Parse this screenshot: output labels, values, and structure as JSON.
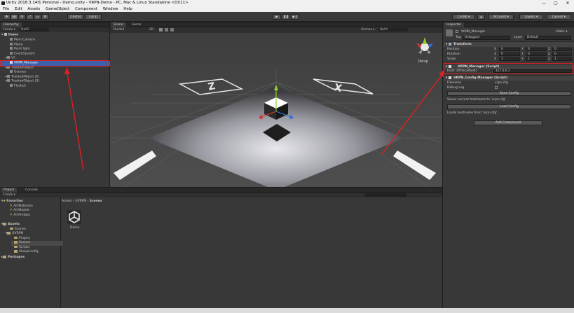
{
  "window": {
    "title": "Unity 2018.3.14f1 Personal - Demo.unity - VRPN-Demo - PC, Mac & Linux Standalone <DX11>",
    "controls": [
      "—",
      "▢",
      "✕"
    ]
  },
  "menu": [
    "File",
    "Edit",
    "Assets",
    "GameObject",
    "Component",
    "Window",
    "Help"
  ],
  "toolbar": {
    "tools": [
      "✥",
      "✛",
      "⟳",
      "⤢",
      "▭",
      "⚙"
    ],
    "center_label": "Center",
    "local_label": "Local",
    "play": "▶",
    "pause": "❚❚",
    "step": "▶❙",
    "collab_label": "Collab ▾",
    "cloud": "☁",
    "account_label": "Account ▾",
    "layers_label": "Layers ▾",
    "layout_label": "Layout ▾"
  },
  "hierarchy": {
    "tab": "Hierarchy",
    "create": "Create ▾",
    "search": "Q▾All",
    "scene_name": "Demo",
    "items": [
      "Main Camera",
      "Plane",
      "Point light",
      "EventSystem",
      "UI",
      "VRPN_Manager",
      "TrackedObject",
      "Glasses",
      "TrackedObject (2)",
      "TrackedObject (3)",
      "Flystick"
    ]
  },
  "scene_view": {
    "tabs": [
      "Scene",
      "Game"
    ],
    "shading": "Shaded",
    "mode_2d": "2D",
    "gizmos": "Gizmos ▾",
    "search": "Q▾All",
    "persp": "Persp",
    "axis_z": "Z",
    "axis_x": "X"
  },
  "inspector": {
    "tab": "Inspector",
    "object_name": "VRPN_Manager",
    "static_label": "Static ▾",
    "tag_label": "Tag",
    "tag_value": "Untagged",
    "layer_label": "Layer",
    "layer_value": "Default",
    "transform": {
      "title": "Transform",
      "position": {
        "label": "Position",
        "x": "0",
        "y": "0",
        "z": "0"
      },
      "rotation": {
        "label": "Rotation",
        "x": "0",
        "y": "0",
        "z": "0"
      },
      "scale": {
        "label": "Scale",
        "x": "1",
        "y": "1",
        "z": "1"
      }
    },
    "vrpn_manager": {
      "title": "VRPN_Manager (Script)",
      "host_label": "Host: (IP/localhost)",
      "host_value": "127.0.0.1"
    },
    "config_manager": {
      "title": "VRPN_Config Manager (Script)",
      "filename_label": "Filename",
      "filename_value": "vrpn.cfg",
      "debug_label": "Debug Log",
      "save_button": "Save Config",
      "save_note": "Saves current hostname to 'vrpn.cfg'.",
      "load_button": "Load Config",
      "load_note": "Loads hostname from 'vrpn.cfg'."
    },
    "add_component": "Add Component"
  },
  "project": {
    "tabs": [
      "Project",
      "Console"
    ],
    "create": "Create ▾",
    "favorites_title": "Favorites",
    "favorites": [
      "All Materials",
      "All Models",
      "All Prefabs"
    ],
    "assets_title": "Assets",
    "assets": [
      "Scenes",
      "UVRPN"
    ],
    "uvrpn_children": [
      "Plugins",
      "Scenes",
      "Scripts",
      "SharpConfig"
    ],
    "packages_title": "Packages",
    "breadcrumb": [
      "Assets",
      "UVRPN",
      "Scenes"
    ],
    "files": [
      {
        "name": "Demo",
        "icon": "unity-logo-icon"
      }
    ]
  },
  "colors": {
    "annotation": "#e02020",
    "selection": "#3d60a8"
  }
}
